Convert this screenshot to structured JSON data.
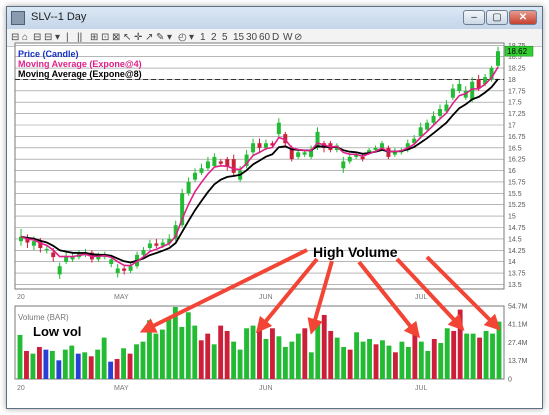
{
  "window": {
    "title": "SLV--1 Day",
    "min_glyph": "–",
    "max_glyph": "▢",
    "close_glyph": "✕"
  },
  "toolbar": {
    "items": [
      "⊟",
      "⌂",
      "⊟",
      "⊟",
      "▾",
      "|",
      "||",
      "⊞",
      "⊡",
      "⊠",
      "↖",
      "✛",
      "↗",
      "✎",
      "▾",
      "◴",
      "▾",
      "1",
      "2",
      "5",
      "15",
      "30",
      "60",
      "D",
      "W",
      "⊘"
    ]
  },
  "annotations": {
    "high_volume": "High Volume",
    "low_volume": "Low vol"
  },
  "colors": {
    "up": "#22bb33",
    "down": "#cc1f3a",
    "ma4": "#e0208a",
    "ma8": "#000000",
    "volume_neutral": "#2a3fd6",
    "arrow": "#f24535",
    "last_price_bg": "#33cc33"
  },
  "price_panel": {
    "legend": {
      "price": "Price (Candle)",
      "ma4": "Moving Average (Expone@4)",
      "ma8": "Moving Average (Expone@8)"
    },
    "y_ticks": [
      "18.75",
      "18.5",
      "18.25",
      "18",
      "17.75",
      "17.5",
      "17.25",
      "17",
      "16.75",
      "16.5",
      "16.25",
      "16",
      "15.75",
      "15.5",
      "15.25",
      "15",
      "14.75",
      "14.5",
      "14.25",
      "14",
      "13.75",
      "13.5"
    ],
    "last_price": "18.62",
    "reference_line": 18.0,
    "x_ticks": [
      "20",
      "MAY",
      "JUN",
      "JUL"
    ]
  },
  "volume_panel": {
    "legend": "Volume (BAR)",
    "y_ticks": [
      "54.7M",
      "41.1M",
      "27.4M",
      "13.7M",
      "0"
    ],
    "x_ticks": [
      "20",
      "MAY",
      "JUN",
      "JUL"
    ]
  },
  "chart_data": {
    "type": "candlestick",
    "ylim": [
      13.4,
      18.8
    ],
    "volume_ylim_millions": [
      0,
      54.7
    ],
    "candles": [
      {
        "o": 14.45,
        "c": 14.55,
        "h": 14.72,
        "l": 14.35
      },
      {
        "o": 14.5,
        "c": 14.42,
        "h": 14.6,
        "l": 14.3
      },
      {
        "o": 14.35,
        "c": 14.45,
        "h": 14.55,
        "l": 14.25
      },
      {
        "o": 14.45,
        "c": 14.3,
        "h": 14.52,
        "l": 14.2
      },
      {
        "o": 14.25,
        "c": 14.28,
        "h": 14.35,
        "l": 14.18
      },
      {
        "o": 14.2,
        "c": 14.1,
        "h": 14.3,
        "l": 14.0
      },
      {
        "o": 13.72,
        "c": 13.9,
        "h": 13.98,
        "l": 13.62
      },
      {
        "o": 14.0,
        "c": 14.12,
        "h": 14.2,
        "l": 13.95
      },
      {
        "o": 14.05,
        "c": 14.1,
        "h": 14.18,
        "l": 14.0
      },
      {
        "o": 14.1,
        "c": 14.18,
        "h": 14.25,
        "l": 14.05
      },
      {
        "o": 14.15,
        "c": 14.2,
        "h": 14.28,
        "l": 14.1
      },
      {
        "o": 14.2,
        "c": 14.05,
        "h": 14.25,
        "l": 13.98
      },
      {
        "o": 14.05,
        "c": 14.12,
        "h": 14.2,
        "l": 14.0
      },
      {
        "o": 14.1,
        "c": 14.15,
        "h": 14.22,
        "l": 14.05
      },
      {
        "o": 13.95,
        "c": 14.05,
        "h": 14.15,
        "l": 13.88
      },
      {
        "o": 13.75,
        "c": 13.85,
        "h": 13.95,
        "l": 13.65
      },
      {
        "o": 13.85,
        "c": 13.8,
        "h": 13.9,
        "l": 13.72
      },
      {
        "o": 13.8,
        "c": 13.9,
        "h": 13.98,
        "l": 13.75
      },
      {
        "o": 13.9,
        "c": 14.15,
        "h": 14.22,
        "l": 13.85
      },
      {
        "o": 14.15,
        "c": 14.25,
        "h": 14.32,
        "l": 14.1
      },
      {
        "o": 14.3,
        "c": 14.4,
        "h": 14.48,
        "l": 14.25
      },
      {
        "o": 14.4,
        "c": 14.35,
        "h": 14.5,
        "l": 14.3
      },
      {
        "o": 14.35,
        "c": 14.42,
        "h": 14.5,
        "l": 14.3
      },
      {
        "o": 14.4,
        "c": 14.5,
        "h": 14.6,
        "l": 14.35
      },
      {
        "o": 14.5,
        "c": 14.8,
        "h": 14.9,
        "l": 14.45
      },
      {
        "o": 14.8,
        "c": 15.5,
        "h": 15.6,
        "l": 14.75
      },
      {
        "o": 15.5,
        "c": 15.75,
        "h": 15.85,
        "l": 15.45
      },
      {
        "o": 15.8,
        "c": 15.95,
        "h": 16.05,
        "l": 15.75
      },
      {
        "o": 15.95,
        "c": 16.05,
        "h": 16.15,
        "l": 15.9
      },
      {
        "o": 16.05,
        "c": 16.2,
        "h": 16.3,
        "l": 16.0
      },
      {
        "o": 16.1,
        "c": 16.3,
        "h": 16.38,
        "l": 16.05
      },
      {
        "o": 16.2,
        "c": 16.15,
        "h": 16.25,
        "l": 16.1
      },
      {
        "o": 16.25,
        "c": 16.08,
        "h": 16.3,
        "l": 16.0
      },
      {
        "o": 16.25,
        "c": 15.95,
        "h": 16.35,
        "l": 15.88
      },
      {
        "o": 15.8,
        "c": 16.0,
        "h": 16.1,
        "l": 15.75
      },
      {
        "o": 16.1,
        "c": 16.35,
        "h": 16.45,
        "l": 16.05
      },
      {
        "o": 16.4,
        "c": 16.6,
        "h": 16.7,
        "l": 16.35
      },
      {
        "o": 16.6,
        "c": 16.5,
        "h": 16.7,
        "l": 16.4
      },
      {
        "o": 16.5,
        "c": 16.6,
        "h": 16.68,
        "l": 16.45
      },
      {
        "o": 16.6,
        "c": 16.55,
        "h": 16.65,
        "l": 16.5
      },
      {
        "o": 16.8,
        "c": 17.05,
        "h": 17.15,
        "l": 16.75
      },
      {
        "o": 16.8,
        "c": 16.6,
        "h": 16.85,
        "l": 16.55
      },
      {
        "o": 16.5,
        "c": 16.25,
        "h": 16.55,
        "l": 16.2
      },
      {
        "o": 16.3,
        "c": 16.4,
        "h": 16.48,
        "l": 16.25
      },
      {
        "o": 16.35,
        "c": 16.4,
        "h": 16.45,
        "l": 16.3
      },
      {
        "o": 16.3,
        "c": 16.45,
        "h": 16.55,
        "l": 16.25
      },
      {
        "o": 16.5,
        "c": 16.85,
        "h": 16.95,
        "l": 16.45
      },
      {
        "o": 16.6,
        "c": 16.5,
        "h": 16.65,
        "l": 16.4
      },
      {
        "o": 16.6,
        "c": 16.45,
        "h": 16.65,
        "l": 16.4
      },
      {
        "o": 16.45,
        "c": 16.55,
        "h": 16.6,
        "l": 16.4
      },
      {
        "o": 16.05,
        "c": 16.2,
        "h": 16.3,
        "l": 15.95
      },
      {
        "o": 16.2,
        "c": 16.3,
        "h": 16.38,
        "l": 16.15
      },
      {
        "o": 16.3,
        "c": 16.35,
        "h": 16.4,
        "l": 16.25
      },
      {
        "o": 16.3,
        "c": 16.25,
        "h": 16.35,
        "l": 16.2
      },
      {
        "o": 16.4,
        "c": 16.45,
        "h": 16.5,
        "l": 16.35
      },
      {
        "o": 16.45,
        "c": 16.5,
        "h": 16.55,
        "l": 16.4
      },
      {
        "o": 16.5,
        "c": 16.6,
        "h": 16.65,
        "l": 16.45
      },
      {
        "o": 16.5,
        "c": 16.3,
        "h": 16.55,
        "l": 16.25
      },
      {
        "o": 16.35,
        "c": 16.42,
        "h": 16.5,
        "l": 16.3
      },
      {
        "o": 16.4,
        "c": 16.45,
        "h": 16.5,
        "l": 16.35
      },
      {
        "o": 16.45,
        "c": 16.6,
        "h": 16.68,
        "l": 16.4
      },
      {
        "o": 16.6,
        "c": 16.7,
        "h": 16.78,
        "l": 16.55
      },
      {
        "o": 16.75,
        "c": 16.95,
        "h": 17.05,
        "l": 16.7
      },
      {
        "o": 16.9,
        "c": 17.05,
        "h": 17.12,
        "l": 16.85
      },
      {
        "o": 17.05,
        "c": 17.2,
        "h": 17.3,
        "l": 17.0
      },
      {
        "o": 17.2,
        "c": 17.35,
        "h": 17.45,
        "l": 17.15
      },
      {
        "o": 17.3,
        "c": 17.45,
        "h": 17.55,
        "l": 17.25
      },
      {
        "o": 17.6,
        "c": 17.8,
        "h": 17.9,
        "l": 17.55
      },
      {
        "o": 17.75,
        "c": 17.9,
        "h": 18.0,
        "l": 17.7
      },
      {
        "o": 17.6,
        "c": 17.75,
        "h": 17.85,
        "l": 17.55
      },
      {
        "o": 17.55,
        "c": 17.95,
        "h": 18.05,
        "l": 17.5
      },
      {
        "o": 18.0,
        "c": 17.8,
        "h": 18.1,
        "l": 17.75
      },
      {
        "o": 17.9,
        "c": 18.05,
        "h": 18.12,
        "l": 17.85
      },
      {
        "o": 18.0,
        "c": 18.25,
        "h": 18.3,
        "l": 17.95
      },
      {
        "o": 18.3,
        "c": 18.62,
        "h": 18.72,
        "l": 18.25
      }
    ],
    "volume": [
      {
        "v": 33,
        "c": "up"
      },
      {
        "v": 21,
        "c": "down"
      },
      {
        "v": 19,
        "c": "up"
      },
      {
        "v": 24,
        "c": "down"
      },
      {
        "v": 22,
        "c": "neutral"
      },
      {
        "v": 21,
        "c": "up"
      },
      {
        "v": 14,
        "c": "neutral"
      },
      {
        "v": 22,
        "c": "up"
      },
      {
        "v": 25,
        "c": "up"
      },
      {
        "v": 19,
        "c": "neutral"
      },
      {
        "v": 20,
        "c": "up"
      },
      {
        "v": 17,
        "c": "down"
      },
      {
        "v": 22,
        "c": "up"
      },
      {
        "v": 31,
        "c": "up"
      },
      {
        "v": 13,
        "c": "neutral"
      },
      {
        "v": 15,
        "c": "down"
      },
      {
        "v": 23,
        "c": "up"
      },
      {
        "v": 19,
        "c": "down"
      },
      {
        "v": 26,
        "c": "up"
      },
      {
        "v": 28,
        "c": "up"
      },
      {
        "v": 44,
        "c": "up"
      },
      {
        "v": 34,
        "c": "up"
      },
      {
        "v": 37,
        "c": "up"
      },
      {
        "v": 45,
        "c": "up"
      },
      {
        "v": 56,
        "c": "up"
      },
      {
        "v": 39,
        "c": "up"
      },
      {
        "v": 50,
        "c": "up"
      },
      {
        "v": 40,
        "c": "up"
      },
      {
        "v": 29,
        "c": "down"
      },
      {
        "v": 34,
        "c": "down"
      },
      {
        "v": 26,
        "c": "up"
      },
      {
        "v": 40,
        "c": "down"
      },
      {
        "v": 36,
        "c": "down"
      },
      {
        "v": 28,
        "c": "up"
      },
      {
        "v": 22,
        "c": "up"
      },
      {
        "v": 38,
        "c": "up"
      },
      {
        "v": 40,
        "c": "up"
      },
      {
        "v": 38,
        "c": "down"
      },
      {
        "v": 30,
        "c": "up"
      },
      {
        "v": 38,
        "c": "down"
      },
      {
        "v": 32,
        "c": "up"
      },
      {
        "v": 24,
        "c": "up"
      },
      {
        "v": 28,
        "c": "up"
      },
      {
        "v": 34,
        "c": "up"
      },
      {
        "v": 38,
        "c": "down"
      },
      {
        "v": 20,
        "c": "up"
      },
      {
        "v": 42,
        "c": "up"
      },
      {
        "v": 48,
        "c": "down"
      },
      {
        "v": 36,
        "c": "down"
      },
      {
        "v": 31,
        "c": "up"
      },
      {
        "v": 24,
        "c": "up"
      },
      {
        "v": 22,
        "c": "down"
      },
      {
        "v": 35,
        "c": "up"
      },
      {
        "v": 28,
        "c": "up"
      },
      {
        "v": 30,
        "c": "up"
      },
      {
        "v": 26,
        "c": "down"
      },
      {
        "v": 29,
        "c": "up"
      },
      {
        "v": 25,
        "c": "up"
      },
      {
        "v": 20,
        "c": "down"
      },
      {
        "v": 28,
        "c": "up"
      },
      {
        "v": 24,
        "c": "up"
      },
      {
        "v": 38,
        "c": "down"
      },
      {
        "v": 28,
        "c": "up"
      },
      {
        "v": 21,
        "c": "up"
      },
      {
        "v": 30,
        "c": "down"
      },
      {
        "v": 27,
        "c": "up"
      },
      {
        "v": 38,
        "c": "up"
      },
      {
        "v": 36,
        "c": "down"
      },
      {
        "v": 52,
        "c": "down"
      },
      {
        "v": 34,
        "c": "up"
      },
      {
        "v": 34,
        "c": "up"
      },
      {
        "v": 31,
        "c": "down"
      },
      {
        "v": 36,
        "c": "up"
      },
      {
        "v": 34,
        "c": "up"
      },
      {
        "v": 43,
        "c": "up"
      }
    ]
  }
}
